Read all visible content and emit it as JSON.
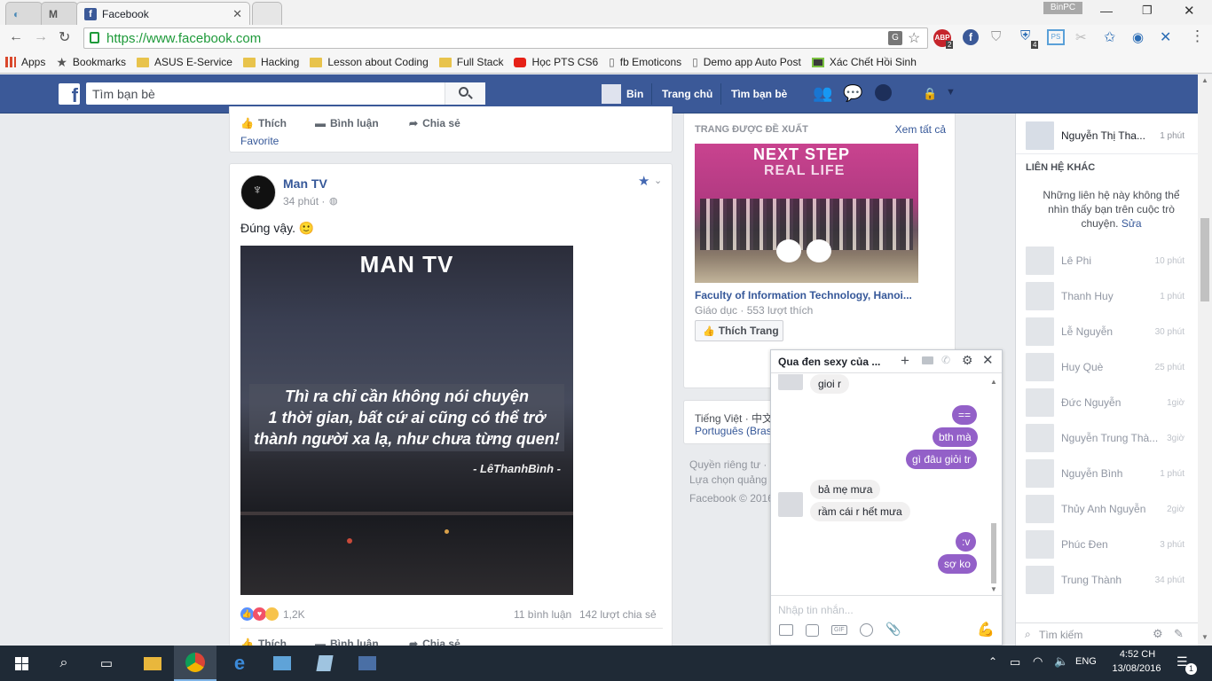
{
  "browser": {
    "tabs": [
      {
        "label": ""
      },
      {
        "label": ""
      },
      {
        "label": "Facebook"
      },
      {
        "label": ""
      }
    ],
    "window_user": "BinPC",
    "url": "https://www.facebook.com",
    "bookmarks": [
      "Apps",
      "Bookmarks",
      "ASUS E-Service",
      "Hacking",
      "Lesson about Coding",
      "Full Stack",
      "Học PTS CS6",
      "fb Emoticons",
      "Demo app Auto Post",
      "Xác Chết Hồi Sinh"
    ],
    "ext_badges": {
      "abp": "2",
      "shield": "4"
    }
  },
  "fb_header": {
    "search_placeholder": "Tìm bạn bè",
    "user": "Bin",
    "home": "Trang chủ",
    "find_friends": "Tìm bạn bè"
  },
  "prev_post": {
    "like": "Thích",
    "comment": "Bình luận",
    "share": "Chia sẻ",
    "favorite": "Favorite"
  },
  "post": {
    "author": "Man TV",
    "time": "34 phút ·",
    "text": "Đúng vậy. 🙂",
    "image_title": "MAN TV",
    "image_quote_1": "Thì ra chỉ cần không nói chuyện",
    "image_quote_2": "1 thời gian, bất cứ ai cũng có thể trở",
    "image_quote_3": "thành người xa lạ, như chưa từng quen!",
    "image_sign": "- LêThanhBình -",
    "reactions": "1,2K",
    "comments": "11 bình luận",
    "shares": "142 lượt chia sẻ",
    "like": "Thích",
    "comment": "Bình luận",
    "share": "Chia sẻ"
  },
  "suggested": {
    "header": "TRANG ĐƯỢC ĐỀ XUẤT",
    "see_all": "Xem tất cả",
    "banner_1": "NEXT STEP",
    "banner_2": "REAL LIFE",
    "page_name": "Faculty of Information Technology, Hanoi...",
    "meta": "Giáo dục · 553 lượt thích",
    "like_page": "Thích Trang"
  },
  "footer": {
    "langs": "Tiếng Việt · 中文",
    "lang2": "Português (Bras",
    "privacy": "Quyền riêng tư ·",
    "ad_choices": "Lựa chọn quảng",
    "copyright": "Facebook © 2016"
  },
  "chat": {
    "title": "Qua đen sexy của ...",
    "messages": [
      {
        "side": "left",
        "text": "gioi r"
      },
      {
        "side": "right",
        "text": "=="
      },
      {
        "side": "right",
        "text": "bth mà"
      },
      {
        "side": "right",
        "text": "gì đâu giỏi tr"
      },
      {
        "side": "left",
        "text": "bả mẹ mưa"
      },
      {
        "side": "left",
        "text": "rầm cái r hết mưa"
      },
      {
        "side": "right",
        "text": ":v"
      },
      {
        "side": "right",
        "text": "sợ ko"
      }
    ],
    "input_placeholder": "Nhập tin nhắn...",
    "gif": "GIF"
  },
  "sidebar": {
    "top_contact": {
      "name": "Nguyễn Thị Tha...",
      "time": "1 phút"
    },
    "other_header": "LIÊN HỆ KHÁC",
    "note": "Những liên hệ này không thể nhìn thấy bạn trên cuộc trò chuyện.",
    "edit": "Sửa",
    "contacts": [
      {
        "name": "Lê Phi",
        "time": "10 phút"
      },
      {
        "name": "Thanh Huy",
        "time": "1 phút"
      },
      {
        "name": "Lễ Nguyễn",
        "time": "30 phút"
      },
      {
        "name": "Huy Què",
        "time": "25 phút"
      },
      {
        "name": "Đức Nguyễn",
        "time": "1giờ"
      },
      {
        "name": "Nguyễn Trung Thà...",
        "time": "3giờ"
      },
      {
        "name": "Nguyễn Bình",
        "time": "1 phút"
      },
      {
        "name": "Thủy Anh Nguyễn",
        "time": "2giờ"
      },
      {
        "name": "Phúc Đen",
        "time": "3 phút"
      },
      {
        "name": "Trung Thành",
        "time": "34 phút"
      }
    ],
    "search_label": "Tìm kiếm"
  },
  "taskbar": {
    "lang": "ENG",
    "time": "4:52 CH",
    "date": "13/08/2016",
    "notif_count": "1"
  }
}
